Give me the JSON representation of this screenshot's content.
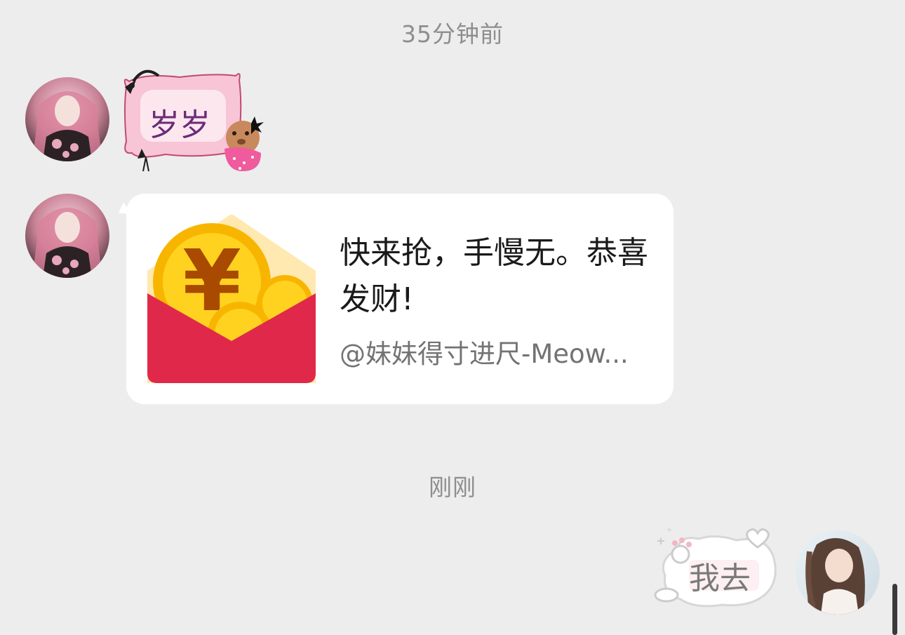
{
  "chat": {
    "timestamps": [
      "35分钟前",
      "刚刚"
    ],
    "messages": [
      {
        "sender": "other",
        "type": "sticker",
        "text": "岁岁"
      },
      {
        "sender": "other",
        "type": "red_packet",
        "icon": "red-envelope-icon",
        "title": "快来抢，手慢无。恭喜发财!",
        "subtitle": "@妹妹得寸进尺-Meow..."
      },
      {
        "sender": "me",
        "type": "sticker",
        "text": "我去"
      }
    ]
  },
  "colors": {
    "background": "#ededed",
    "card": "#ffffff",
    "envelope_red": "#e0294a",
    "coin_gold": "#f7b500",
    "timestamp": "#8e8e8e"
  }
}
